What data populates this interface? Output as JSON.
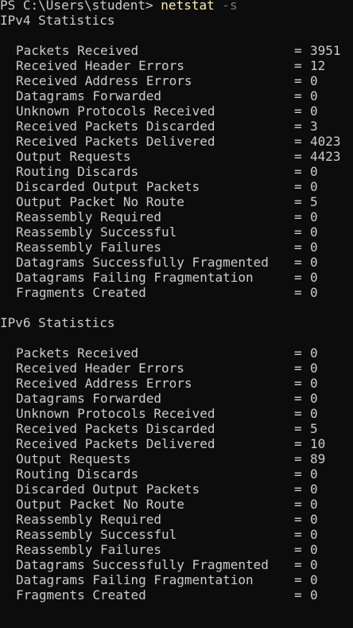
{
  "prompt": {
    "path": "PS C:\\Users\\student> ",
    "command": "netstat",
    "argument": "-s"
  },
  "sections": [
    {
      "title": "IPv4 Statistics",
      "stats": [
        {
          "label": "Packets Received",
          "value": "3951"
        },
        {
          "label": "Received Header Errors",
          "value": "12"
        },
        {
          "label": "Received Address Errors",
          "value": "0"
        },
        {
          "label": "Datagrams Forwarded",
          "value": "0"
        },
        {
          "label": "Unknown Protocols Received",
          "value": "0"
        },
        {
          "label": "Received Packets Discarded",
          "value": "3"
        },
        {
          "label": "Received Packets Delivered",
          "value": "4023"
        },
        {
          "label": "Output Requests",
          "value": "4423"
        },
        {
          "label": "Routing Discards",
          "value": "0"
        },
        {
          "label": "Discarded Output Packets",
          "value": "0"
        },
        {
          "label": "Output Packet No Route",
          "value": "5"
        },
        {
          "label": "Reassembly Required",
          "value": "0"
        },
        {
          "label": "Reassembly Successful",
          "value": "0"
        },
        {
          "label": "Reassembly Failures",
          "value": "0"
        },
        {
          "label": "Datagrams Successfully Fragmented",
          "value": "0"
        },
        {
          "label": "Datagrams Failing Fragmentation",
          "value": "0"
        },
        {
          "label": "Fragments Created",
          "value": "0"
        }
      ]
    },
    {
      "title": "IPv6 Statistics",
      "stats": [
        {
          "label": "Packets Received",
          "value": "0"
        },
        {
          "label": "Received Header Errors",
          "value": "0"
        },
        {
          "label": "Received Address Errors",
          "value": "0"
        },
        {
          "label": "Datagrams Forwarded",
          "value": "0"
        },
        {
          "label": "Unknown Protocols Received",
          "value": "0"
        },
        {
          "label": "Received Packets Discarded",
          "value": "5"
        },
        {
          "label": "Received Packets Delivered",
          "value": "10"
        },
        {
          "label": "Output Requests",
          "value": "89"
        },
        {
          "label": "Routing Discards",
          "value": "0"
        },
        {
          "label": "Discarded Output Packets",
          "value": "0"
        },
        {
          "label": "Output Packet No Route",
          "value": "0"
        },
        {
          "label": "Reassembly Required",
          "value": "0"
        },
        {
          "label": "Reassembly Successful",
          "value": "0"
        },
        {
          "label": "Reassembly Failures",
          "value": "0"
        },
        {
          "label": "Datagrams Successfully Fragmented",
          "value": "0"
        },
        {
          "label": "Datagrams Failing Fragmentation",
          "value": "0"
        },
        {
          "label": "Fragments Created",
          "value": "0"
        }
      ]
    }
  ],
  "colors": {
    "background": "#0c0c0c",
    "text": "#cccccc",
    "command": "#f9f1a5",
    "argument": "#767676"
  }
}
